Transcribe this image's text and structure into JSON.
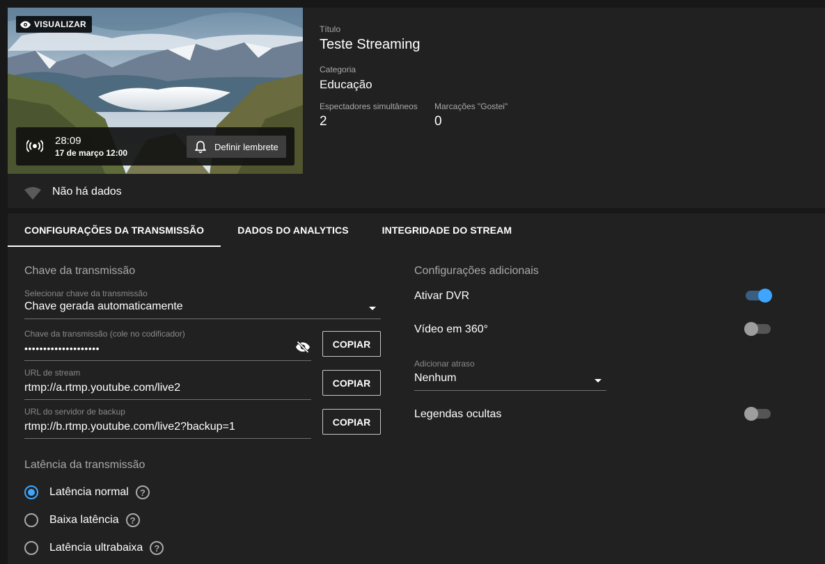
{
  "preview": {
    "badge_label": "VISUALIZAR",
    "duration": "28:09",
    "scheduled": "17 de março 12:00",
    "reminder_label": "Definir lembrete"
  },
  "details": {
    "title_label": "Título",
    "title_value": "Teste Streaming",
    "category_label": "Categoria",
    "category_value": "Educação",
    "viewers_label": "Espectadores simultâneos",
    "viewers_value": "2",
    "likes_label": "Marcações \"Gostei\"",
    "likes_value": "0"
  },
  "status": {
    "text": "Não há dados"
  },
  "tabs": [
    {
      "label": "CONFIGURAÇÕES DA TRANSMISSÃO",
      "active": true
    },
    {
      "label": "DADOS DO ANALYTICS",
      "active": false
    },
    {
      "label": "INTEGRIDADE DO STREAM",
      "active": false
    }
  ],
  "stream_key": {
    "section_title": "Chave da transmissão",
    "select_label": "Selecionar chave da transmissão",
    "select_value": "Chave gerada automaticamente",
    "key_label": "Chave da transmissão (cole no codificador)",
    "key_value": "••••••••••••••••••••",
    "url_label": "URL de stream",
    "url_value": "rtmp://a.rtmp.youtube.com/live2",
    "backup_label": "URL do servidor de backup",
    "backup_value": "rtmp://b.rtmp.youtube.com/live2?backup=1",
    "copy_label": "COPIAR"
  },
  "latency": {
    "section_title": "Latência da transmissão",
    "options": [
      {
        "label": "Latência normal",
        "selected": true
      },
      {
        "label": "Baixa latência",
        "selected": false
      },
      {
        "label": "Latência ultrabaixa",
        "selected": false
      }
    ],
    "help_glyph": "?"
  },
  "additional": {
    "section_title": "Configurações adicionais",
    "dvr_label": "Ativar DVR",
    "dvr_on": true,
    "video360_label": "Vídeo em 360°",
    "video360_on": false,
    "delay_label": "Adicionar atraso",
    "delay_value": "Nenhum",
    "captions_label": "Legendas ocultas",
    "captions_on": false
  },
  "colors": {
    "background": "#181818",
    "card": "#212121",
    "accent": "#3ea6ff",
    "muted_text": "#aaaaaa"
  },
  "icons": [
    "eye-icon",
    "live-broadcast-icon",
    "bell-icon",
    "wifi-icon",
    "eye-off-icon",
    "help-icon",
    "dropdown-arrow-icon"
  ]
}
